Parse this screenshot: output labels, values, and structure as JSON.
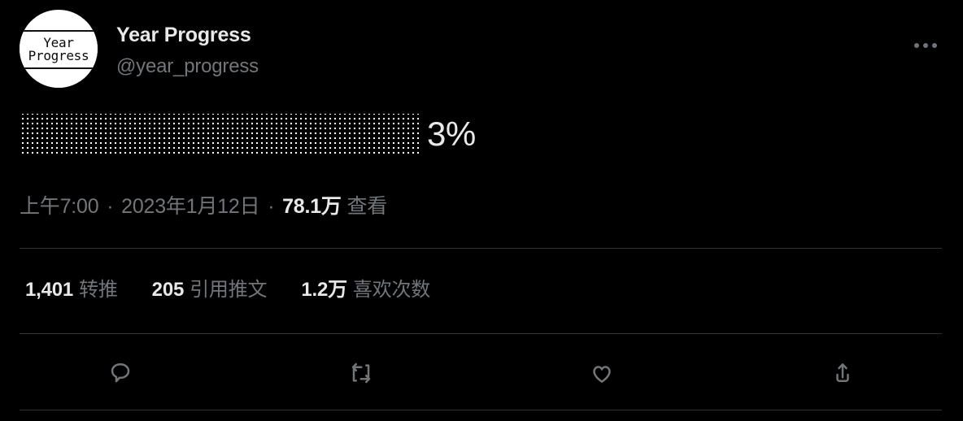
{
  "account": {
    "display_name": "Year Progress",
    "handle": "@year_progress",
    "avatar_line1": "Year",
    "avatar_line2": "Progress"
  },
  "header": {
    "more_icon": "more-horizontal-icon"
  },
  "content": {
    "progress_percent_label": "3%",
    "progress_percent_value": 3,
    "progress_fill_char": "▓"
  },
  "meta": {
    "time": "上午7:00",
    "separator": "·",
    "date": "2023年1月12日",
    "views_count": "78.1万",
    "views_label": "查看"
  },
  "stats": [
    {
      "count": "1,401",
      "label": "转推"
    },
    {
      "count": "205",
      "label": "引用推文"
    },
    {
      "count": "1.2万",
      "label": "喜欢次数"
    }
  ],
  "actions": [
    {
      "name": "reply",
      "icon": "comment-icon"
    },
    {
      "name": "retweet",
      "icon": "retweet-icon"
    },
    {
      "name": "like",
      "icon": "heart-icon"
    },
    {
      "name": "share",
      "icon": "share-icon"
    }
  ],
  "colors": {
    "background": "#000000",
    "text_primary": "#e7e9ea",
    "text_secondary": "#71767b",
    "divider": "#2f3336"
  }
}
